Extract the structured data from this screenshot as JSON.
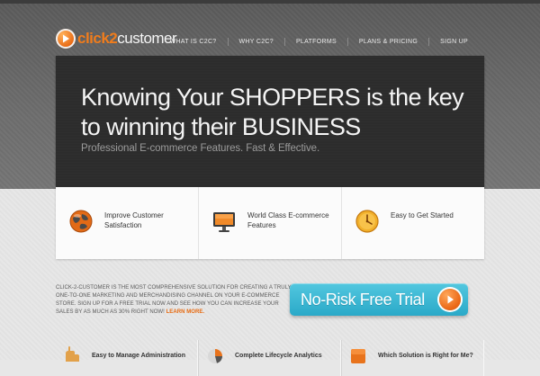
{
  "logo": {
    "mark_text": "",
    "text_part1": "click2",
    "text_part2": "customer"
  },
  "nav": {
    "items": [
      {
        "label": "WHAT IS C2C?"
      },
      {
        "label": "WHY C2C?"
      },
      {
        "label": "PLATFORMS"
      },
      {
        "label": "PLANS & PRICING"
      },
      {
        "label": "SIGN UP"
      }
    ]
  },
  "hero": {
    "title_line1": "Knowing Your SHOPPERS is the key",
    "title_line2": "to winning their BUSINESS",
    "subtitle": "Professional E-commerce Features. Fast & Effective."
  },
  "features": [
    {
      "text": "Improve Customer Satisfaction",
      "icon": "globe-icon"
    },
    {
      "text": "World Class E-commerce Features",
      "icon": "monitor-icon"
    },
    {
      "text": "Easy to Get Started",
      "icon": "clock-icon"
    }
  ],
  "info": {
    "text": "CLICK-2-CUSTOMER IS THE MOST COMPREHENSIVE SOLUTION FOR CREATING A TRULY ONE-TO-ONE MARKETING AND MERCHANDISING CHANNEL ON YOUR E-COMMERCE STORE. SIGN UP FOR A FREE TRIAL NOW AND SEE HOW YOU CAN INCREASE YOUR SALES BY AS MUCH AS 30% RIGHT NOW!",
    "link_label": "LEARN MORE."
  },
  "trial_button": {
    "label": "No-Risk Free Trial"
  },
  "cards": [
    {
      "title": "Easy to Manage Administration",
      "icon": "hand-icon"
    },
    {
      "title": "Complete Lifecycle Analytics",
      "icon": "chart-icon"
    },
    {
      "title": "Which Solution is Right for Me?",
      "icon": "question-icon"
    }
  ],
  "colors": {
    "accent_orange": "#f07c1c",
    "button_blue": "#36b4d2",
    "hero_bg": "#2c2c2c"
  }
}
